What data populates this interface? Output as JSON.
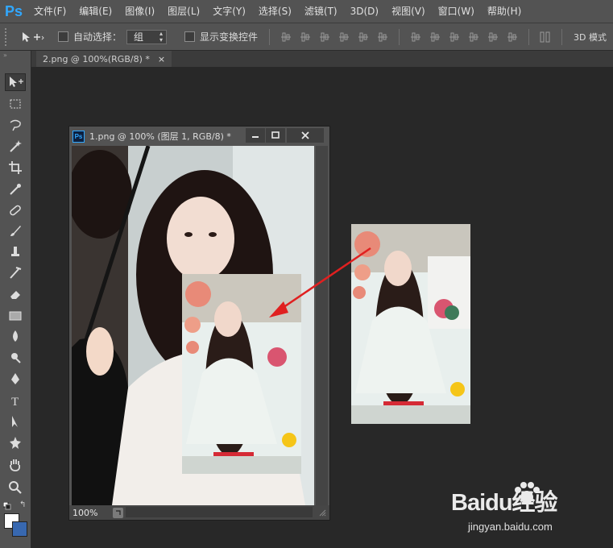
{
  "app": {
    "logo": "Ps",
    "menu": [
      "文件(F)",
      "编辑(E)",
      "图像(I)",
      "图层(L)",
      "文字(Y)",
      "选择(S)",
      "滤镜(T)",
      "3D(D)",
      "视图(V)",
      "窗口(W)",
      "帮助(H)"
    ]
  },
  "options": {
    "auto_select_label": "自动选择：",
    "group_value": "组",
    "show_transform_label": "显示变换控件",
    "mode_3d_label": "3D 模式"
  },
  "tools": [
    "move-tool",
    "marquee-tool",
    "lasso-tool",
    "magic-wand-tool",
    "crop-tool",
    "eyedropper-tool",
    "healing-brush-tool",
    "brush-tool",
    "clone-stamp-tool",
    "history-brush-tool",
    "eraser-tool",
    "gradient-tool",
    "blur-tool",
    "dodge-tool",
    "pen-tool",
    "type-tool",
    "path-selection-tool",
    "custom-shape-tool",
    "hand-tool",
    "zoom-tool"
  ],
  "type_tool_glyph": "T",
  "document_tab": {
    "label": "2.png @ 100%(RGB/8) *",
    "close": "×"
  },
  "floating_window": {
    "ps_icon": "Ps",
    "title": "1.png @ 100% (图层 1, RGB/8) *",
    "zoom": "100%"
  },
  "colors": {
    "foreground": "#ffffff",
    "background": "#3868b0",
    "accent": "#31a8ff",
    "arrow": "#e02020"
  },
  "watermark": {
    "logo": "Baidu经验",
    "url": "jingyan.baidu.com"
  }
}
